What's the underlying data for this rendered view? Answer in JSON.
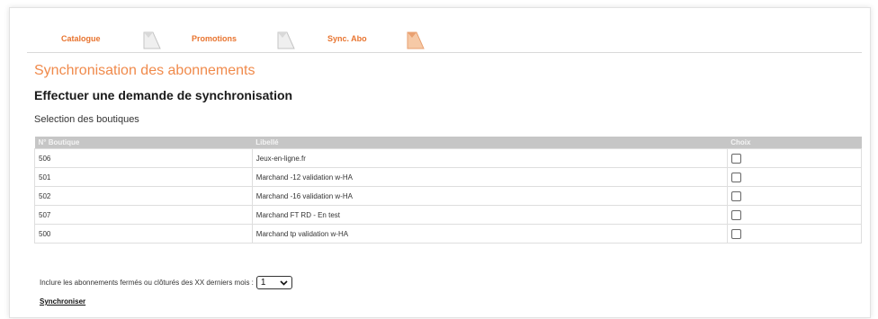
{
  "tabs": [
    {
      "label": "Catalogue",
      "color": "#e8742f"
    },
    {
      "label": "Promotions",
      "color": "#e8742f"
    },
    {
      "label": "Sync. Abo",
      "color": "#e8742f"
    }
  ],
  "page": {
    "title": "Synchronisation des abonnements",
    "subtitle": "Effectuer une demande de synchronisation",
    "section_label": "Selection des boutiques"
  },
  "table": {
    "headers": [
      "N° Boutique",
      "Libellé",
      "Choix"
    ],
    "rows": [
      {
        "num": "506",
        "label": "Jeux-en-ligne.fr",
        "checked": false
      },
      {
        "num": "501",
        "label": "Marchand -12 validation w-HA",
        "checked": false
      },
      {
        "num": "502",
        "label": "Marchand -16 validation w-HA",
        "checked": false
      },
      {
        "num": "507",
        "label": "Marchand FT RD - En test",
        "checked": false
      },
      {
        "num": "500",
        "label": "Marchand tp validation w-HA",
        "checked": false
      }
    ]
  },
  "include": {
    "label": "Inclure les abonnements fermés ou clôturés des XX derniers mois :",
    "selected": "1"
  },
  "actions": {
    "sync_label": "Synchroniser"
  },
  "colors": {
    "accent": "#f08a4b",
    "header_bg": "#c6c6c6"
  }
}
